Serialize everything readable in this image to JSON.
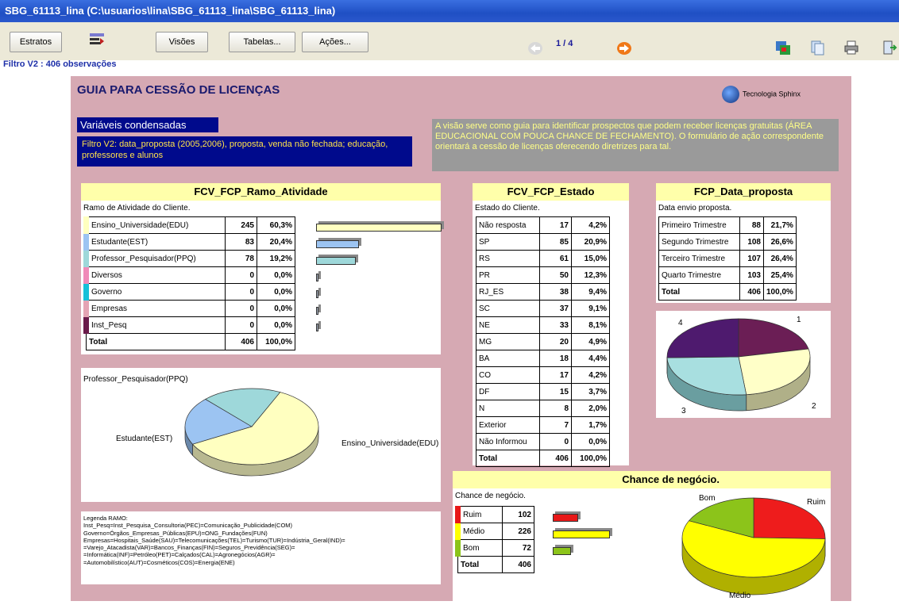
{
  "window": {
    "title": "SBG_61113_lina (C:\\usuarios\\lina\\SBG_61113_lina\\SBG_61113_lina)"
  },
  "toolbar": {
    "estratos": "Estratos",
    "visoes": "Visões",
    "tabelas": "Tabelas...",
    "acoes": "Ações...",
    "page": "1 / 4",
    "filter": "Filtro V2 : 406 observações"
  },
  "header": {
    "title": "GUIA PARA CESSÃO DE LICENÇAS",
    "brand": "Tecnologia Sphinx"
  },
  "variaveis": {
    "title": "Variáveis condensadas",
    "text": "Filtro V2: data_proposta (2005,2006), proposta, venda não fechada; educação, professores e alunos"
  },
  "visao_text": "A visão serve como guia para identificar prospectos que podem receber licenças gratuitas (ÁREA EDUCACIONAL COM POUCA CHANCE DE FECHAMENTO). O formulário de ação correspondente orientará a cessão de licenças oferecendo diretrizes para tal.",
  "ramo": {
    "title": "FCV_FCP_Ramo_Atividade",
    "subtitle": "Ramo de Atividade do Cliente.",
    "rows": [
      {
        "label": "Ensino_Universidade(EDU)",
        "n": "245",
        "pct": "60,3%",
        "color": "#ffffc0"
      },
      {
        "label": "Estudante(EST)",
        "n": "83",
        "pct": "20,4%",
        "color": "#9cc4f2"
      },
      {
        "label": "Professor_Pesquisador(PPQ)",
        "n": "78",
        "pct": "19,2%",
        "color": "#9ed8da"
      },
      {
        "label": "Diversos",
        "n": "0",
        "pct": "0,0%",
        "color": "#f08ab8"
      },
      {
        "label": "Governo",
        "n": "0",
        "pct": "0,0%",
        "color": "#18c0d8"
      },
      {
        "label": "Empresas",
        "n": "0",
        "pct": "0,0%",
        "color": "#e4a4b4"
      },
      {
        "label": "Inst_Pesq",
        "n": "0",
        "pct": "0,0%",
        "color": "#6a1a4a"
      }
    ],
    "total": {
      "label": "Total",
      "n": "406",
      "pct": "100,0%"
    }
  },
  "ramo_pie": {
    "labels": [
      "Professor_Pesquisador(PPQ)",
      "Estudante(EST)",
      "Ensino_Universidade(EDU)"
    ]
  },
  "legend": {
    "lines": [
      "Legenda RAMO:",
      "Inst_Pesq=Inst_Pesquisa_Consultoria(PEC)=Comunicação_Publicidade(COM)",
      "Governo=Órgãos_Empresas_Públicas(EPU)=ONG_Fundações(FUN)",
      "Empresas=Hospitais_Saúde(SAU)=Telecomunicações(TEL)=Turismo(TUR)=Indústria_Geral(IND)=",
      "=Varejo_Atacadista(VAR)=Bancos_Finanças(FIN)=Seguros_Previdência(SEG)=",
      "=Informática(INF)=Petróleo(PET)=Calçados(CAL)=Agronegócios(AGR)=",
      "=Automobilístico(AUT)=Cosméticos(COS)=Energia(ENE)"
    ]
  },
  "estado": {
    "title": "FCV_FCP_Estado",
    "subtitle": "Estado do Cliente.",
    "rows": [
      {
        "label": "Não resposta",
        "n": "17",
        "pct": "4,2%"
      },
      {
        "label": "SP",
        "n": "85",
        "pct": "20,9%"
      },
      {
        "label": "RS",
        "n": "61",
        "pct": "15,0%"
      },
      {
        "label": "PR",
        "n": "50",
        "pct": "12,3%"
      },
      {
        "label": "RJ_ES",
        "n": "38",
        "pct": "9,4%"
      },
      {
        "label": "SC",
        "n": "37",
        "pct": "9,1%"
      },
      {
        "label": "NE",
        "n": "33",
        "pct": "8,1%"
      },
      {
        "label": "MG",
        "n": "20",
        "pct": "4,9%"
      },
      {
        "label": "BA",
        "n": "18",
        "pct": "4,4%"
      },
      {
        "label": "CO",
        "n": "17",
        "pct": "4,2%"
      },
      {
        "label": "DF",
        "n": "15",
        "pct": "3,7%"
      },
      {
        "label": "N",
        "n": "8",
        "pct": "2,0%"
      },
      {
        "label": "Exterior",
        "n": "7",
        "pct": "1,7%"
      },
      {
        "label": "Não Informou",
        "n": "0",
        "pct": "0,0%"
      }
    ],
    "total": {
      "label": "Total",
      "n": "406",
      "pct": "100,0%"
    }
  },
  "data_proposta": {
    "title": "FCP_Data_proposta",
    "subtitle": "Data envio proposta.",
    "rows": [
      {
        "label": "Primeiro Trimestre",
        "n": "88",
        "pct": "21,7%"
      },
      {
        "label": "Segundo Trimestre",
        "n": "108",
        "pct": "26,6%"
      },
      {
        "label": "Terceiro Trimestre",
        "n": "107",
        "pct": "26,4%"
      },
      {
        "label": "Quarto Trimestre",
        "n": "103",
        "pct": "25,4%"
      }
    ],
    "total": {
      "label": "Total",
      "n": "406",
      "pct": "100,0%"
    },
    "pie_labels": [
      "1",
      "2",
      "3",
      "4"
    ]
  },
  "chance": {
    "title": "Chance de negócio.",
    "subtitle": "Chance de negócio.",
    "rows": [
      {
        "label": "Ruim",
        "n": "102",
        "color": "#e81818"
      },
      {
        "label": "Médio",
        "n": "226",
        "color": "#ffff00"
      },
      {
        "label": "Bom",
        "n": "72",
        "color": "#8cc41a"
      }
    ],
    "total": {
      "label": "Total",
      "n": "406"
    },
    "pie_labels": [
      "Bom",
      "Ruim",
      "Médio"
    ]
  }
}
